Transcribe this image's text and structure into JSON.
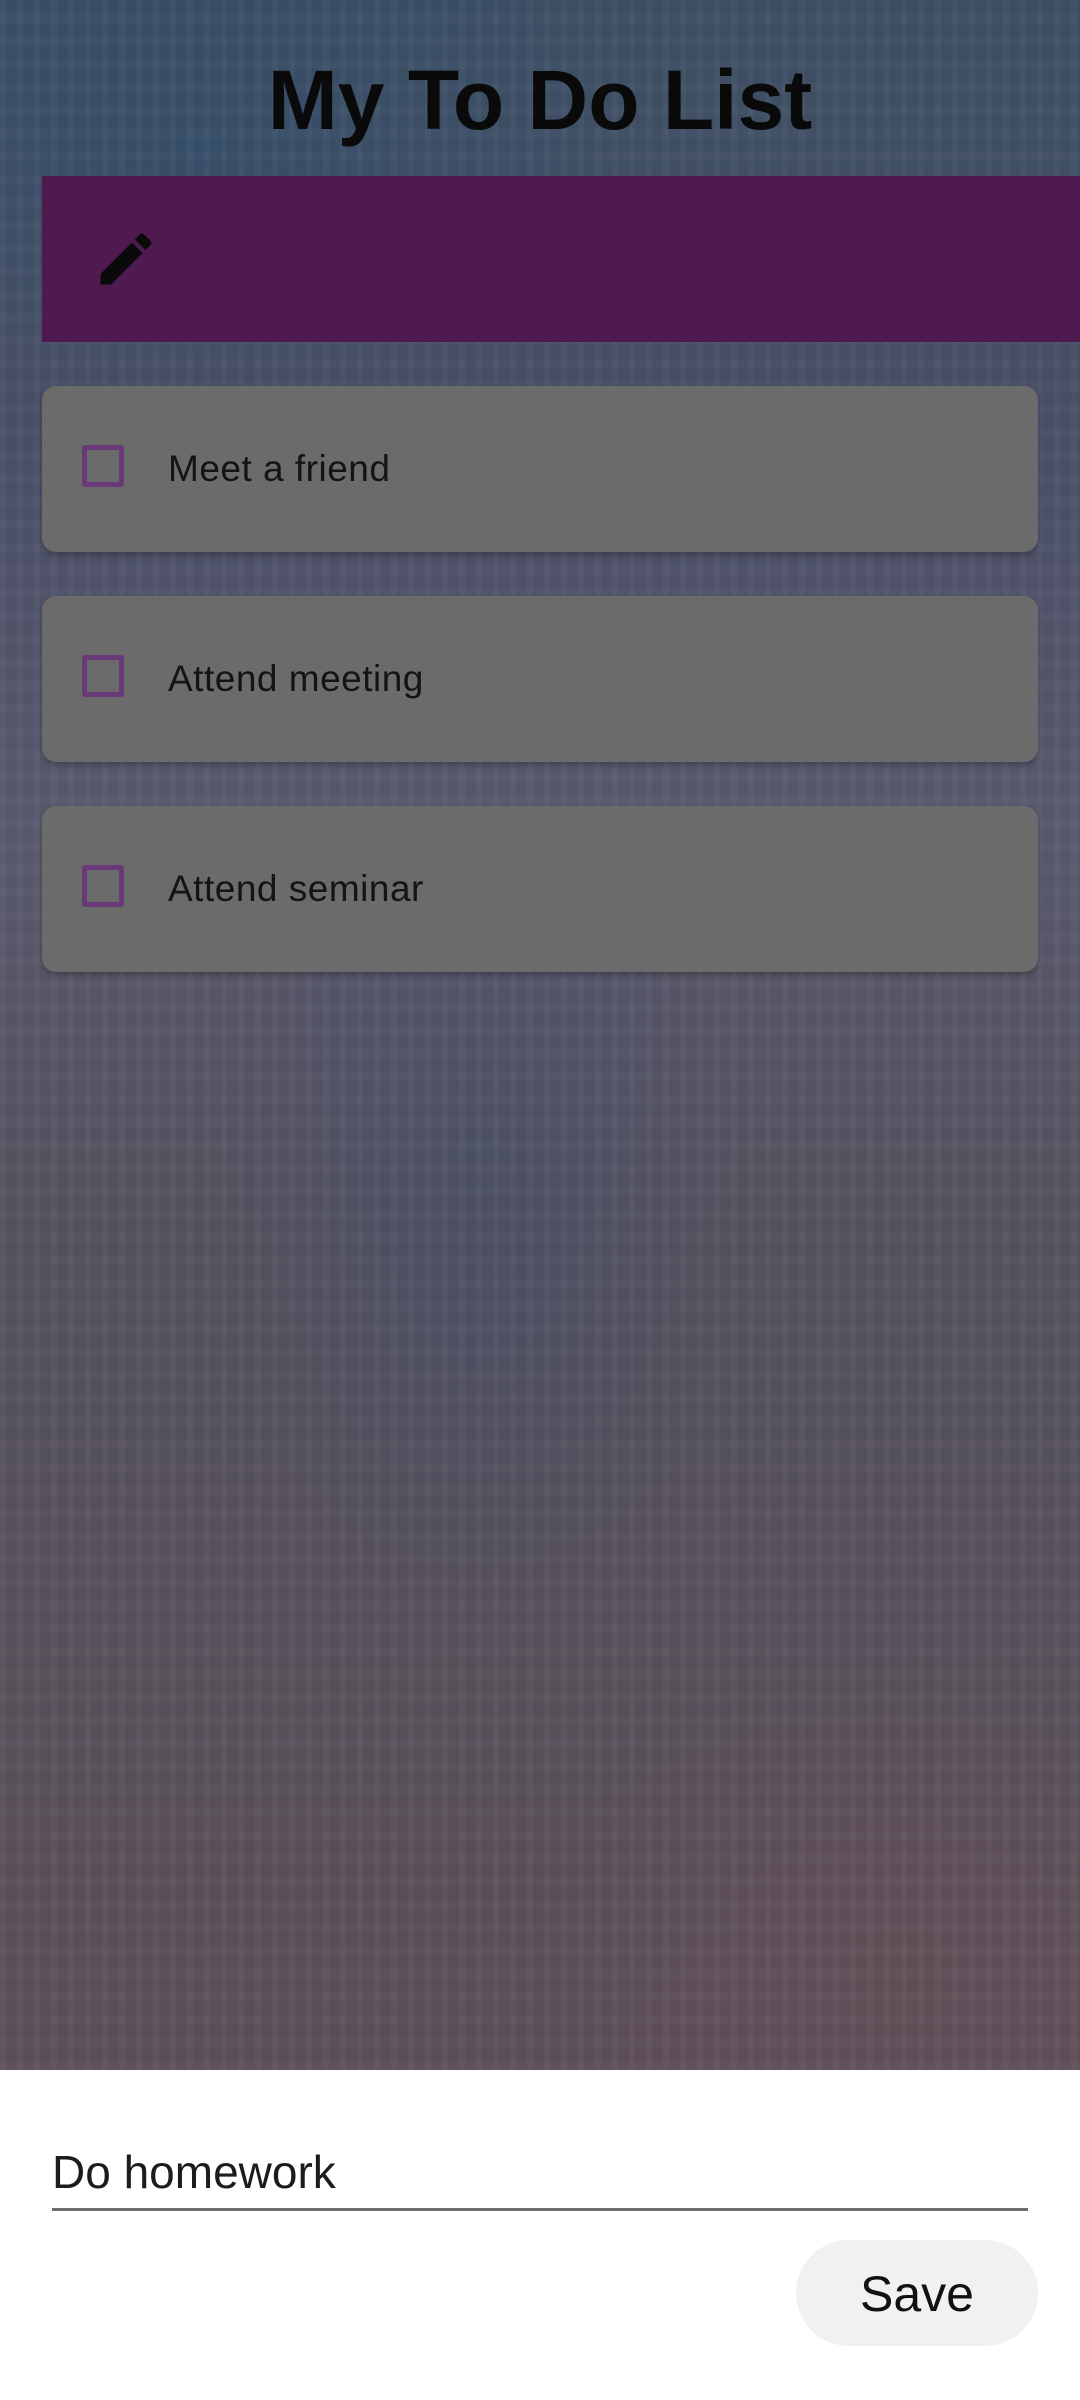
{
  "app": {
    "title": "My To Do List"
  },
  "new_task_bar": {
    "icon": "pencil-icon",
    "color": "#4e1a4f"
  },
  "tasks": [
    {
      "label": "Meet a friend",
      "checked": false
    },
    {
      "label": "Attend meeting",
      "checked": false
    },
    {
      "label": "Attend seminar",
      "checked": false
    }
  ],
  "editor": {
    "value": "Do homework",
    "save_label": "Save"
  },
  "colors": {
    "checkbox_border": "#6a3a78",
    "card_background": "#6b6b6b"
  }
}
